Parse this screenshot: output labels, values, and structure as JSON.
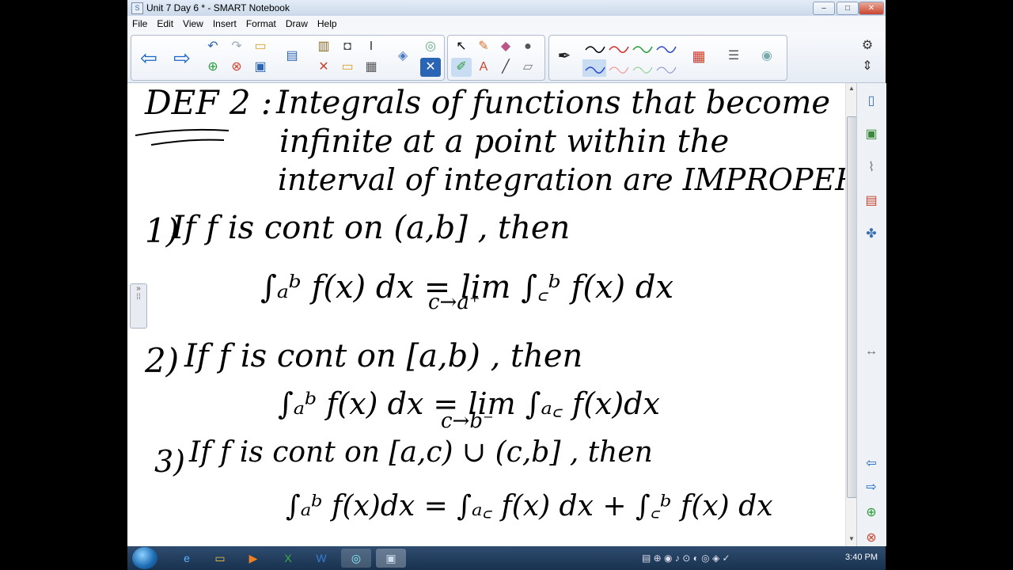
{
  "window": {
    "title": "Unit 7 Day 6 * - SMART Notebook",
    "app_icon": "notebook-icon",
    "buttons": {
      "minimize": "–",
      "maximize": "□",
      "close": "✕"
    }
  },
  "menu": [
    "File",
    "Edit",
    "View",
    "Insert",
    "Format",
    "Draw",
    "Help"
  ],
  "toolbar": {
    "icons": [
      "back-arrow-icon",
      "forward-arrow-icon",
      "undo-icon",
      "redo-icon",
      "open-folder-icon",
      "add-page-icon",
      "delete-page-icon",
      "save-icon",
      "screen-shade-icon",
      "paste-icon",
      "delete-icon",
      "capture-icon",
      "table-icon",
      "text-recognition-icon",
      "select-icon",
      "magic-pen-icon",
      "eraser-icon",
      "pen-icon",
      "text-icon",
      "line-icon",
      "fill-icon",
      "color-palette-icon",
      "properties-icon",
      "settings-icon",
      "move-toolbar-icon"
    ]
  },
  "canvas": {
    "heading": "DEF 2 :",
    "def_lines": [
      "Integrals of functions that become",
      "infinite at a point within the",
      "interval of integration are IMPROPER."
    ],
    "items": [
      {
        "num": "1)",
        "cond": "If f is cont on (a,b] , then",
        "formula": "∫ₐᵇ f(x) dx = lim  ∫꜀ᵇ f(x) dx",
        "limit": "c→a⁺"
      },
      {
        "num": "2)",
        "cond": "If f is cont on [a,b) , then",
        "formula": "∫ₐᵇ f(x) dx = lim  ∫ₐ꜀ f(x)dx",
        "limit": "c→b⁻"
      },
      {
        "num": "3)",
        "cond": "If f is cont on [a,c) ∪ (c,b] , then",
        "formula": "∫ₐᵇ f(x)dx = ∫ₐ꜀ f(x) dx + ∫꜀ᵇ f(x) dx",
        "limit": ""
      }
    ]
  },
  "taskbar": {
    "clock": "3:40 PM",
    "apps": [
      "ie-icon",
      "explorer-icon",
      "media-player-icon",
      "excel-icon",
      "word-icon",
      "browser-icon",
      "notebook-icon"
    ]
  },
  "colors": {
    "accent": "#1a65c8",
    "pen_black": "#000000",
    "pen_red": "#d42a2a",
    "pen_green": "#2a9a3a",
    "pen_blue": "#2a4ac8"
  }
}
